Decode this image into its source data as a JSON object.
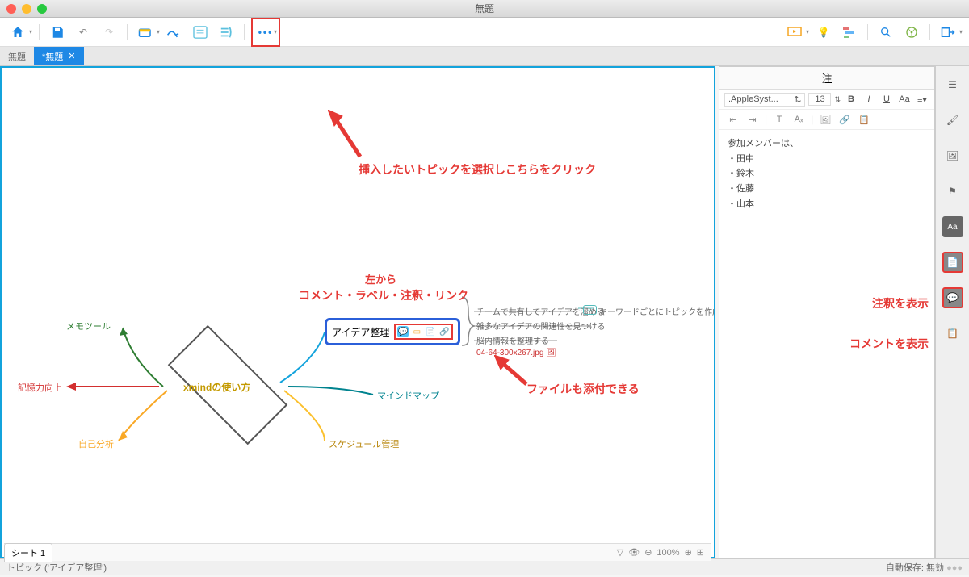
{
  "window": {
    "title": "無題"
  },
  "tabs": {
    "inactive": "無題",
    "active": "*無題"
  },
  "toolbar": {
    "home": "home",
    "save": "save",
    "undo": "undo",
    "redo": "redo",
    "open": "open",
    "relation": "relation",
    "boundary": "boundary",
    "summary": "summary",
    "more": "more",
    "right": {
      "pres": "presentation",
      "idea": "brainstorm",
      "gantt": "gantt",
      "search": "search",
      "share": "share",
      "export": "export"
    }
  },
  "mindmap": {
    "central": "xmindの使い方",
    "branches": {
      "memo": "メモツール",
      "memory": "記憶力向上",
      "self": "自己分析",
      "mind": "マインドマップ",
      "sched": "スケジュール管理",
      "idea": "アイデア整理"
    },
    "idea_children": {
      "c1": "チームで共有してアイデアを溜める",
      "c2": "雑多なアイデアの関連性を見つける",
      "c3": "脳内情報を整理する",
      "file": "04-64-300x267.jpg",
      "linked": "キーワードごとにトピックを作成"
    }
  },
  "annotations": {
    "a1": "挿入したいトピックを選択しこちらをクリック",
    "a2_title": "左から",
    "a2_body": "コメント・ラベル・注釈・リンク",
    "a3": "ファイルも添付できる",
    "a4": "注釈を表示",
    "a5": "コメントを表示"
  },
  "panel": {
    "title": "注",
    "font": ".AppleSyst...",
    "size": "13",
    "content_lines": [
      "参加メンバーは、",
      "・田中",
      "・鈴木",
      "・佐藤",
      "・山本"
    ]
  },
  "sheet": {
    "name": "シート 1",
    "zoom": "100%"
  },
  "statusbar": {
    "left": "トピック ('アイデア整理')",
    "right": "自動保存: 無効"
  }
}
